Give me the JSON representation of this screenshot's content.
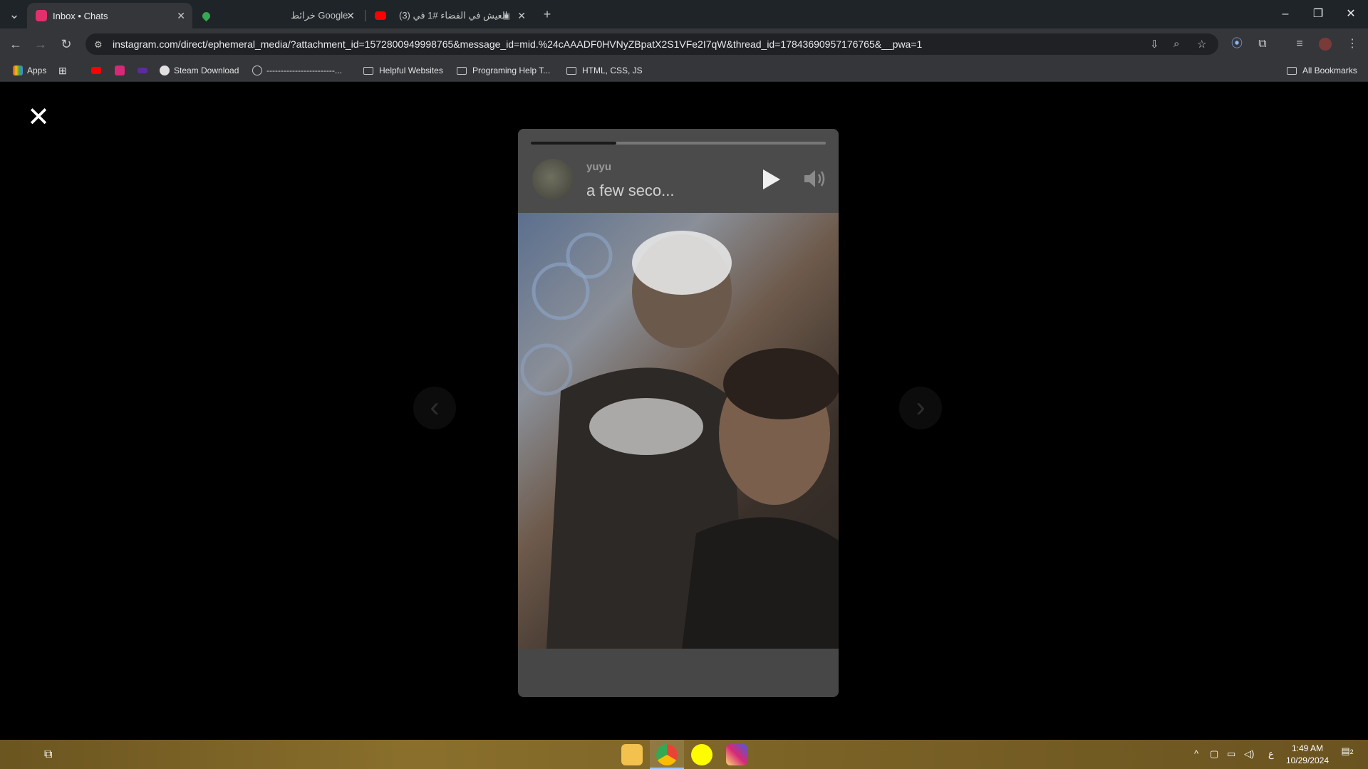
{
  "tabs": [
    {
      "title": "Inbox • Chats",
      "active": true,
      "favicon_color": "#e1306c"
    },
    {
      "title": "",
      "active": false,
      "favicon_color": "#34a853"
    },
    {
      "title": "خرائط Google",
      "active": false,
      "favicon_color": "#4285f4"
    },
    {
      "title": "(3) العيش في الفضاء #1 في",
      "active": false,
      "favicon_color": "#ff0000"
    }
  ],
  "toolbar": {
    "url": "instagram.com/direct/ephemeral_media/?attachment_id=1572800949998765&message_id=mid.%24cAAADF0HVNyZBpatX2S1VFe2I7qW&thread_id=17843690957176765&__pwa=1"
  },
  "bookmarks": {
    "apps_label": "Apps",
    "steam_label": "Steam Download",
    "dashes_label": "------------------------...",
    "folders": [
      "Helpful Websites",
      "Programing Help T...",
      "HTML, CSS, JS"
    ],
    "all_label": "All Bookmarks"
  },
  "story": {
    "username": "yuyu",
    "time": "a few seco...",
    "progress": 0.29
  },
  "taskbar": {
    "time": "1:49 AM",
    "date": "10/29/2024",
    "notifications": "2",
    "lang": "ع"
  }
}
